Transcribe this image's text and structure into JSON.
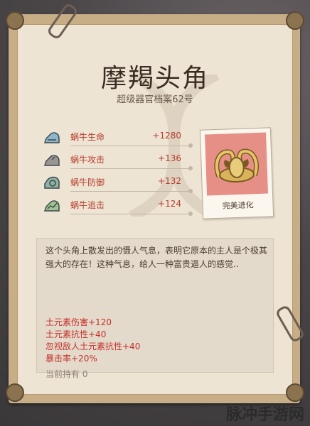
{
  "item": {
    "name": "摩羯头角",
    "subtitle": "超级器官档案62号",
    "badge": "完美进化"
  },
  "stats": [
    {
      "name": "蜗牛生命",
      "value": "+1280",
      "icon": "shell-health-icon"
    },
    {
      "name": "蜗牛攻击",
      "value": "+136",
      "icon": "shell-attack-icon"
    },
    {
      "name": "蜗牛防御",
      "value": "+132",
      "icon": "shell-defense-icon"
    },
    {
      "name": "蜗牛追击",
      "value": "+124",
      "icon": "shell-pursuit-icon"
    }
  ],
  "description": "这个头角上散发出的慑人气息，表明它原本的主人是个极其强大的存在！这种气息，给人一种富贵逼人的感觉..",
  "effects": [
    "土元素伤害+120",
    "土元素抗性+40",
    "忽视敌人土元素抗性+40",
    "暴击率+20%"
  ],
  "holding": "当前持有  0",
  "watermark": "脉冲手游网",
  "colors": {
    "accent_red": "#c4302b",
    "photo_bg": "#e58f86",
    "paper": "#ede4d3"
  }
}
